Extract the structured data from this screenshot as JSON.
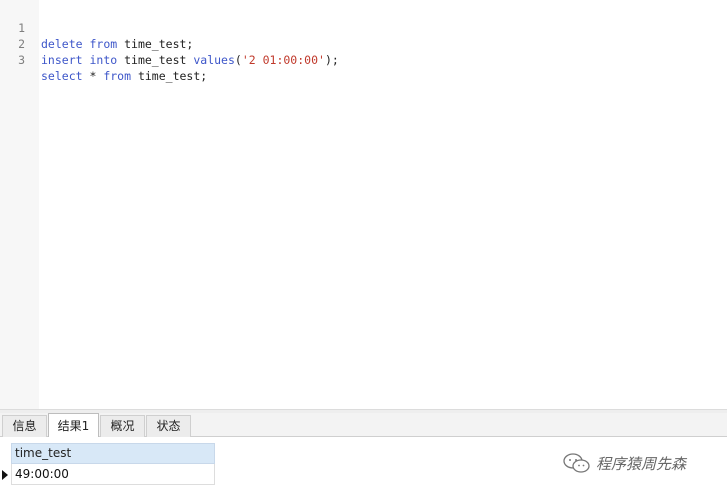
{
  "editor": {
    "lines": [
      {
        "number": "1",
        "tokens": [
          {
            "text": "delete",
            "type": "kw"
          },
          {
            "text": " ",
            "type": "plain"
          },
          {
            "text": "from",
            "type": "kw"
          },
          {
            "text": " time_test;",
            "type": "plain"
          }
        ]
      },
      {
        "number": "2",
        "tokens": [
          {
            "text": "insert",
            "type": "kw"
          },
          {
            "text": " ",
            "type": "plain"
          },
          {
            "text": "into",
            "type": "kw"
          },
          {
            "text": " time_test ",
            "type": "plain"
          },
          {
            "text": "values",
            "type": "kw"
          },
          {
            "text": "(",
            "type": "plain"
          },
          {
            "text": "'2 01:00:00'",
            "type": "str"
          },
          {
            "text": ");",
            "type": "plain"
          }
        ]
      },
      {
        "number": "3",
        "tokens": [
          {
            "text": "select",
            "type": "kw"
          },
          {
            "text": " * ",
            "type": "plain"
          },
          {
            "text": "from",
            "type": "kw"
          },
          {
            "text": " time_test;",
            "type": "plain"
          }
        ]
      }
    ]
  },
  "tabs": [
    {
      "label": "信息",
      "active": false
    },
    {
      "label": "结果1",
      "active": true
    },
    {
      "label": "概况",
      "active": false
    },
    {
      "label": "状态",
      "active": false
    }
  ],
  "result": {
    "column": "time_test",
    "rows": [
      "49:00:00"
    ]
  },
  "watermark": {
    "text": "程序猿周先森",
    "icon": "wechat-icon"
  },
  "colors": {
    "keyword": "#3d56c9",
    "string": "#c0392b",
    "header_bg": "#d8e8f7"
  }
}
